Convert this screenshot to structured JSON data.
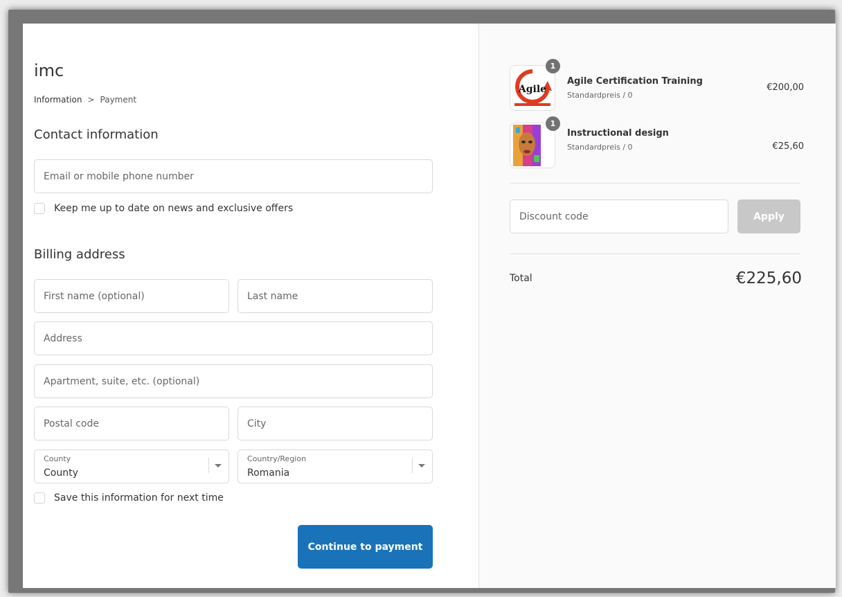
{
  "brand": "imc",
  "breadcrumb": {
    "current": "Information",
    "separator": ">",
    "next": "Payment"
  },
  "contact": {
    "title": "Contact information",
    "email_placeholder": "Email or mobile phone number",
    "newsletter_label": "Keep me up to date on news and exclusive offers"
  },
  "billing": {
    "title": "Billing address",
    "first_name_placeholder": "First name (optional)",
    "last_name_placeholder": "Last name",
    "address_placeholder": "Address",
    "apartment_placeholder": "Apartment, suite, etc. (optional)",
    "postal_placeholder": "Postal code",
    "city_placeholder": "City",
    "county": {
      "label": "County",
      "value": "County"
    },
    "country": {
      "label": "Country/Region",
      "value": "Romania"
    },
    "save_label": "Save this information for next time"
  },
  "continue_label": "Continue to payment",
  "cart": {
    "items": [
      {
        "name": "Agile Certification Training",
        "variant": "Standardpreis / 0",
        "price": "€200,00",
        "quantity": "1",
        "logo_text": "Agile"
      },
      {
        "name": "Instructional design",
        "variant": "Standardpreis / 0",
        "price": "€25,60",
        "quantity": "1"
      }
    ],
    "discount_placeholder": "Discount code",
    "apply_label": "Apply",
    "total_label": "Total",
    "total_value": "€225,60"
  },
  "colors": {
    "primary": "#1a73b8",
    "apply_disabled": "#c8c8c8",
    "badge": "#727272"
  }
}
